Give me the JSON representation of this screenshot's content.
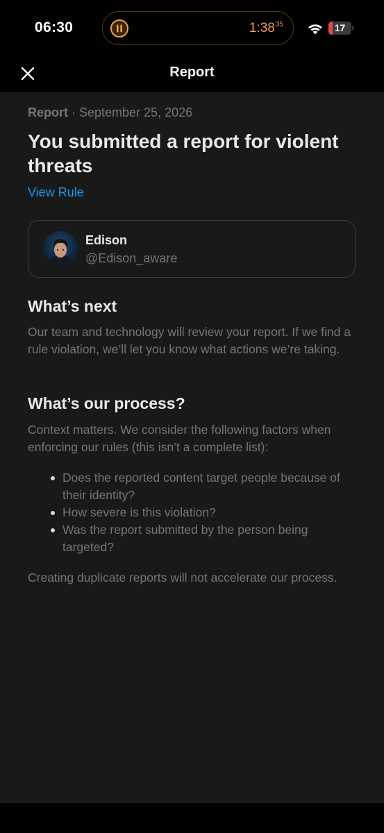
{
  "status_bar": {
    "time": "06:30",
    "timer": {
      "main": "1:38",
      "fraction": "35",
      "state": "paused",
      "icon": "pause-timer-icon"
    },
    "wifi_icon": "wifi-icon",
    "battery": {
      "level": "17",
      "fill_fraction": 0.17,
      "color": "#e5484d"
    }
  },
  "nav": {
    "close_icon": "close-icon",
    "title": "Report"
  },
  "report": {
    "label": "Report",
    "separator": " · ",
    "date": "September 25, 2026",
    "headline": "You submitted a report for violent threats",
    "view_rule": "View Rule",
    "account": {
      "name": "Edison",
      "handle": "@Edison_aware"
    }
  },
  "whats_next": {
    "title": "What’s next",
    "body": "Our team and technology will review your report. If we find a rule violation, we’ll let you know what actions we’re taking."
  },
  "process": {
    "title": "What’s our process?",
    "intro": "Context matters. We consider the following factors when enforcing our rules (this isn’t a complete list):",
    "factors": [
      "Does the reported content target people because of their identity?",
      "How severe is this violation?",
      "Was the report submitted by the person being targeted?"
    ],
    "footer": "Creating duplicate reports will not accelerate our process."
  },
  "colors": {
    "accent": "#1d9bf0",
    "background": "#191919",
    "secondary_text": "#71767b",
    "timer": "#f0a050"
  }
}
